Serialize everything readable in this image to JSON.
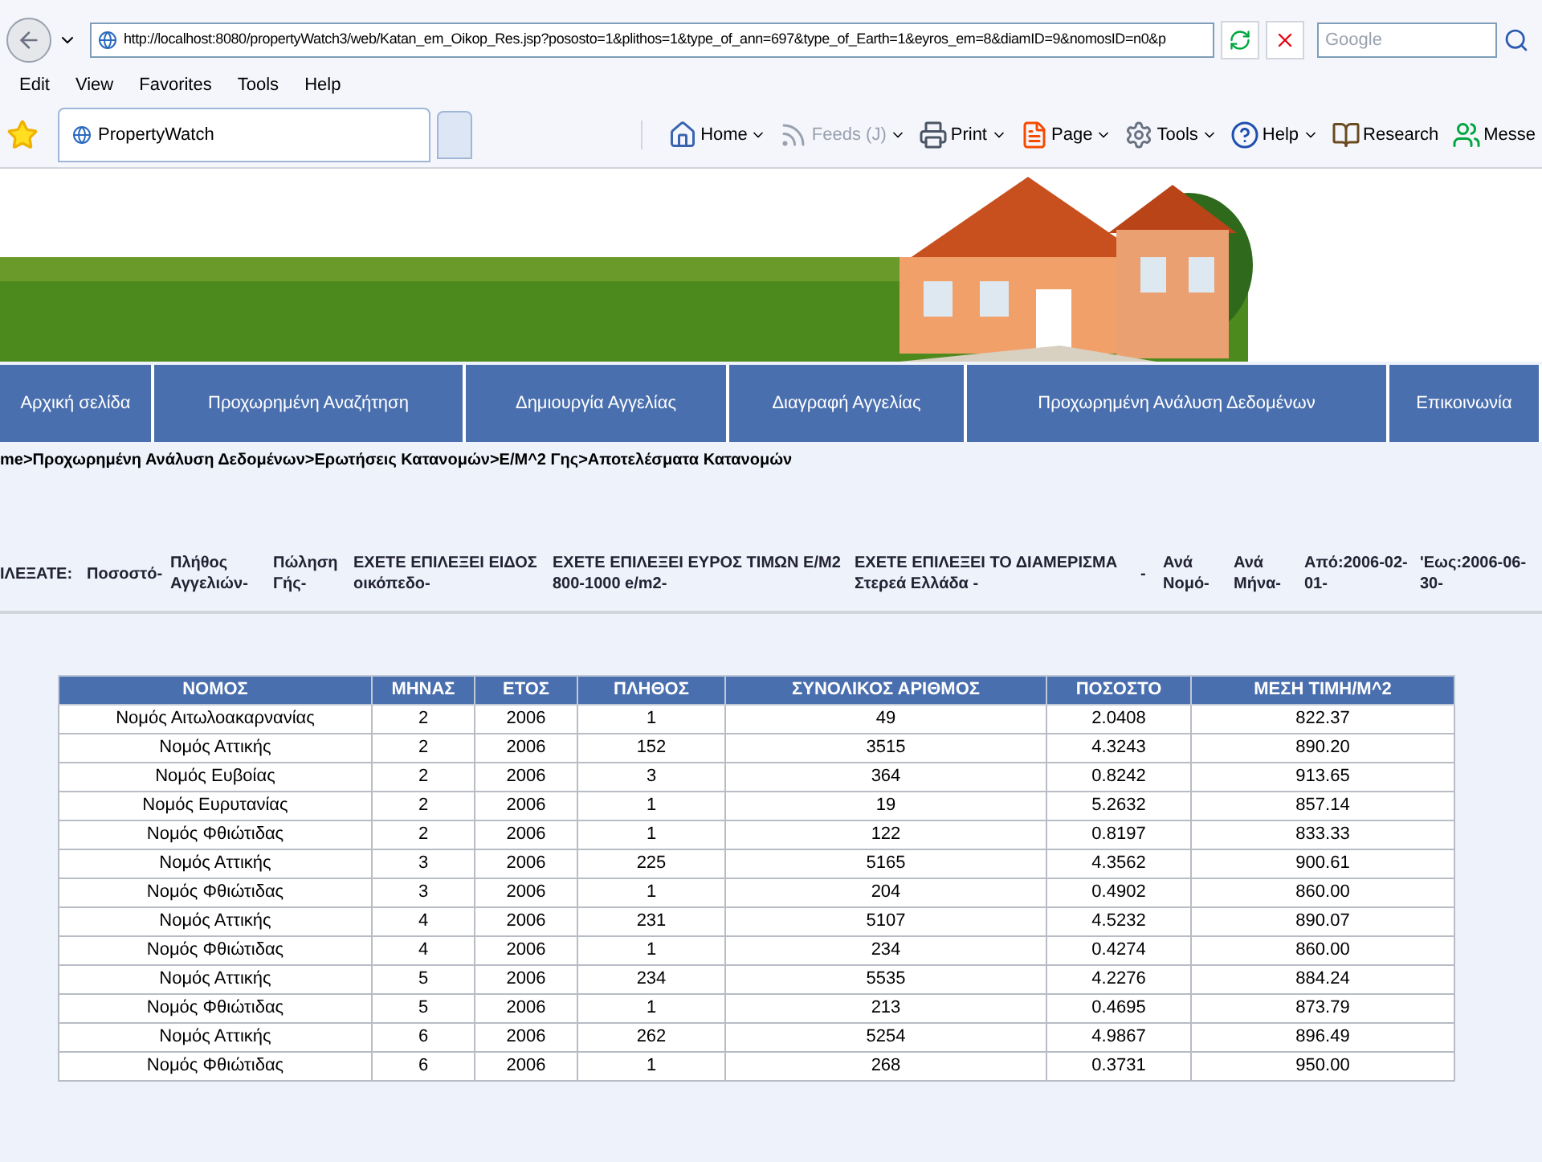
{
  "browser": {
    "address": "http://localhost:8080/propertyWatch3/web/Katan_em_Oikop_Res.jsp?pososto=1&plithos=1&type_of_ann=697&type_of_Earth=1&eyros_em=8&diamID=9&nomosID=n0&p",
    "search": {
      "placeholder": "Google"
    },
    "menu": [
      "Edit",
      "View",
      "Favorites",
      "Tools",
      "Help"
    ],
    "tab": {
      "title": "PropertyWatch"
    },
    "commands": [
      {
        "label": "Home",
        "kind": "home",
        "disabled": false,
        "caret": true
      },
      {
        "label": "Feeds (J)",
        "kind": "feeds",
        "disabled": true,
        "caret": true
      },
      {
        "label": "Print",
        "kind": "print",
        "disabled": false,
        "caret": true
      },
      {
        "label": "Page",
        "kind": "page",
        "disabled": false,
        "caret": true
      },
      {
        "label": "Tools",
        "kind": "tools",
        "disabled": false,
        "caret": true
      },
      {
        "label": "Help",
        "kind": "help",
        "disabled": false,
        "caret": true
      },
      {
        "label": "Research",
        "kind": "research",
        "disabled": false,
        "caret": false
      },
      {
        "label": "Messe",
        "kind": "messenger",
        "disabled": false,
        "caret": false
      }
    ]
  },
  "nav": [
    "Αρχική σελίδα",
    "Προχωρημένη Αναζήτηση",
    "Δημιουργία Αγγελίας",
    "Διαγραφή Αγγελίας",
    "Προχωρημένη Ανάλυση Δεδομένων",
    "Επικοινωνία"
  ],
  "breadcrumb": "me>Προχωρημένη Ανάλυση Δεδομένων>Ερωτήσεις Κατανομών>Ε/Μ^2 Γης>Αποτελέσματα Κατανομών",
  "filters": {
    "label": "ΙΛΕΞΑΤΕ:",
    "items": [
      {
        "lines": [
          "Ποσοστό-"
        ]
      },
      {
        "lines": [
          "Πλήθος",
          "Αγγελιών-"
        ]
      },
      {
        "lines": [
          "Πώληση",
          "Γής-"
        ]
      },
      {
        "lines": [
          "ΕΧΕΤΕ ΕΠΙΛΕΞΕΙ ΕΙΔΟΣ",
          "οικόπεδο-"
        ]
      },
      {
        "lines": [
          "ΕΧΕΤΕ ΕΠΙΛΕΞΕΙ ΕΥΡΟΣ ΤΙΜΩΝ Ε/Μ2",
          "800-1000 e/m2-"
        ]
      },
      {
        "lines": [
          "ΕΧΕΤΕ ΕΠΙΛΕΞΕΙ ΤΟ ΔΙΑΜΕΡΙΣΜΑ",
          "Στερεά Ελλάδα -"
        ]
      },
      {
        "lines": [
          "-"
        ]
      },
      {
        "lines": [
          "Ανά",
          "Νομό-"
        ]
      },
      {
        "lines": [
          "Ανά",
          "Μήνα-"
        ]
      },
      {
        "lines": [
          "Από:2006-02-",
          "01-"
        ]
      },
      {
        "lines": [
          "'Εως:2006-06-",
          "30-"
        ]
      }
    ]
  },
  "table": {
    "columns": [
      "ΝΟΜΟΣ",
      "ΜΗΝΑΣ",
      "ΕΤΟΣ",
      "ΠΛΗΘΟΣ",
      "ΣΥΝΟΛΙΚΟΣ ΑΡΙΘΜΟΣ",
      "ΠΟΣΟΣΤΟ",
      "ΜΕΣΗ ΤΙΜΗ/Μ^2"
    ],
    "rows": [
      [
        "Νομός Αιτωλοακαρνανίας",
        "2",
        "2006",
        "1",
        "49",
        "2.0408",
        "822.37"
      ],
      [
        "Νομός Αττικής",
        "2",
        "2006",
        "152",
        "3515",
        "4.3243",
        "890.20"
      ],
      [
        "Νομός Ευβοίας",
        "2",
        "2006",
        "3",
        "364",
        "0.8242",
        "913.65"
      ],
      [
        "Νομός Ευρυτανίας",
        "2",
        "2006",
        "1",
        "19",
        "5.2632",
        "857.14"
      ],
      [
        "Νομός Φθιώτιδας",
        "2",
        "2006",
        "1",
        "122",
        "0.8197",
        "833.33"
      ],
      [
        "Νομός Αττικής",
        "3",
        "2006",
        "225",
        "5165",
        "4.3562",
        "900.61"
      ],
      [
        "Νομός Φθιώτιδας",
        "3",
        "2006",
        "1",
        "204",
        "0.4902",
        "860.00"
      ],
      [
        "Νομός Αττικής",
        "4",
        "2006",
        "231",
        "5107",
        "4.5232",
        "890.07"
      ],
      [
        "Νομός Φθιώτιδας",
        "4",
        "2006",
        "1",
        "234",
        "0.4274",
        "860.00"
      ],
      [
        "Νομός Αττικής",
        "5",
        "2006",
        "234",
        "5535",
        "4.2276",
        "884.24"
      ],
      [
        "Νομός Φθιώτιδας",
        "5",
        "2006",
        "1",
        "213",
        "0.4695",
        "873.79"
      ],
      [
        "Νομός Αττικής",
        "6",
        "2006",
        "262",
        "5254",
        "4.9867",
        "896.49"
      ],
      [
        "Νομός Φθιώτιδας",
        "6",
        "2006",
        "1",
        "268",
        "0.3731",
        "950.00"
      ]
    ]
  }
}
